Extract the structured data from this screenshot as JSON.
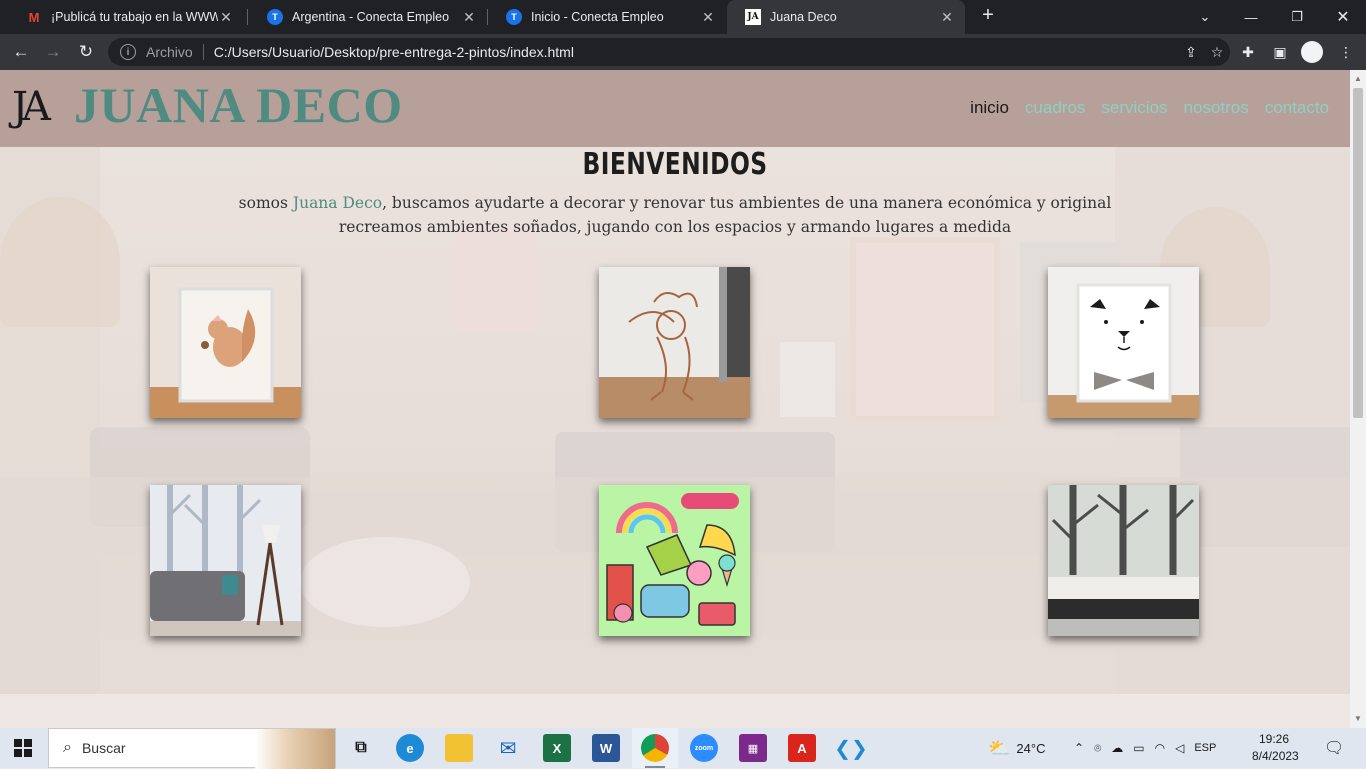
{
  "browser": {
    "tabs": [
      {
        "title": "¡Publicá tu trabajo en la WWW d",
        "icon": "gmail-icon",
        "active": false
      },
      {
        "title": "Argentina - Conecta Empleo",
        "icon": "t-icon",
        "active": false
      },
      {
        "title": "Inicio - Conecta Empleo",
        "icon": "t-icon",
        "active": false
      },
      {
        "title": "Juana Deco",
        "icon": "juana-deco-favicon",
        "active": true
      }
    ],
    "address": {
      "scheme_label": "Archivo",
      "url": "C:/Users/Usuario/Desktop/pre-entrega-2-pintos/index.html"
    }
  },
  "site": {
    "logo_mark": "JA",
    "logo_text": "JUANA DECO",
    "menu": [
      {
        "label": "inicio",
        "current": true
      },
      {
        "label": "cuadros",
        "current": false
      },
      {
        "label": "servicios",
        "current": false
      },
      {
        "label": "nosotros",
        "current": false
      },
      {
        "label": "contacto",
        "current": false
      }
    ],
    "title": "BIENVENIDOS",
    "intro_prefix": "somos ",
    "intro_brand": "Juana Deco",
    "intro_rest": ", buscamos ayudarte a decorar y renovar tus ambientes de una manera económica y original",
    "intro_line2": "recreamos ambientes soñados, jugando con los espacios y armando lugares a medida",
    "colors": {
      "header_bg": "#b7a09a",
      "brand": "#4f8b80",
      "menu_link": "#8fcfc4"
    },
    "gallery": [
      {
        "name": "squirrel-print"
      },
      {
        "name": "chef-sketch-print"
      },
      {
        "name": "bear-bowtie-print"
      },
      {
        "name": "tree-wall-living-room"
      },
      {
        "name": "sticker-collage"
      },
      {
        "name": "tree-wall-bedroom"
      }
    ]
  },
  "taskbar": {
    "search_placeholder": "Buscar",
    "weather": "24°C",
    "lang": "ESP",
    "time": "19:26",
    "date": "8/4/2023"
  }
}
